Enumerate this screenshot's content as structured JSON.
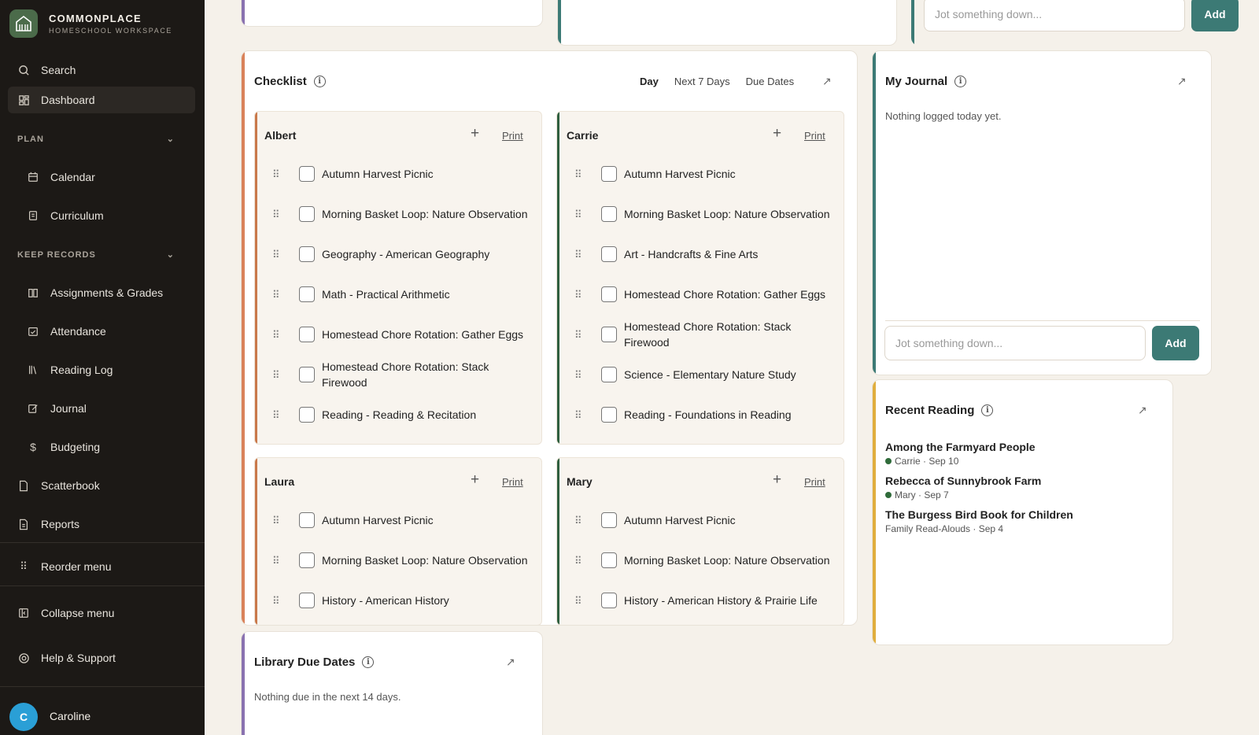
{
  "brand": {
    "name": "COMMONPLACE",
    "subtitle": "HOMESCHOOL WORKSPACE"
  },
  "nav": {
    "search": "Search",
    "dashboard": "Dashboard",
    "plan_section": "PLAN",
    "calendar": "Calendar",
    "curriculum": "Curriculum",
    "records_section": "KEEP RECORDS",
    "assignments": "Assignments & Grades",
    "attendance": "Attendance",
    "reading_log": "Reading Log",
    "journal": "Journal",
    "budgeting": "Budgeting",
    "scatterbook": "Scatterbook",
    "reports": "Reports",
    "reorder": "Reorder menu",
    "collapse": "Collapse menu",
    "help": "Help & Support"
  },
  "user": {
    "initial": "C",
    "name": "Caroline"
  },
  "top": {
    "jot_placeholder": "Jot something down...",
    "add": "Add"
  },
  "checklist": {
    "title": "Checklist",
    "tabs": [
      "Day",
      "Next 7 Days",
      "Due Dates"
    ],
    "print": "Print",
    "kids": [
      {
        "name": "Albert",
        "color": "#c9784a",
        "tasks": [
          "Autumn Harvest Picnic",
          "Morning Basket Loop: Nature Observation",
          "Geography - American Geography",
          "Math - Practical Arithmetic",
          "Homestead Chore Rotation: Gather Eggs",
          "Homestead Chore Rotation: Stack Firewood",
          "Reading - Reading & Recitation"
        ]
      },
      {
        "name": "Carrie",
        "color": "#2f5f3f",
        "tasks": [
          "Autumn Harvest Picnic",
          "Morning Basket Loop: Nature Observation",
          "Art - Handcrafts & Fine Arts",
          "Homestead Chore Rotation: Gather Eggs",
          "Homestead Chore Rotation: Stack Firewood",
          "Science - Elementary Nature Study",
          "Reading - Foundations in Reading"
        ]
      },
      {
        "name": "Laura",
        "color": "#c9784a",
        "tasks": [
          "Autumn Harvest Picnic",
          "Morning Basket Loop: Nature Observation",
          "History - American History"
        ]
      },
      {
        "name": "Mary",
        "color": "#2f5f3f",
        "tasks": [
          "Autumn Harvest Picnic",
          "Morning Basket Loop: Nature Observation",
          "History - American History & Prairie Life"
        ]
      }
    ]
  },
  "journal": {
    "title": "My Journal",
    "empty": "Nothing logged today yet.",
    "placeholder": "Jot something down...",
    "add": "Add"
  },
  "reading": {
    "title": "Recent Reading",
    "items": [
      {
        "title": "Among the Farmyard People",
        "meta": "Carrie · Sep 10",
        "dot": true
      },
      {
        "title": "Rebecca of Sunnybrook Farm",
        "meta": "Mary · Sep 7",
        "dot": true
      },
      {
        "title": "The Burgess Bird Book for Children",
        "meta": "Family Read-Alouds · Sep 4",
        "dot": false
      }
    ]
  },
  "library": {
    "title": "Library Due Dates",
    "empty": "Nothing due in the next 14 days."
  },
  "colors": {
    "accent": "#3c7a75",
    "sidebar": "#1c1916",
    "checklist_bar": "#d9825a",
    "journal_bar": "#3c7a75",
    "reading_bar": "#e0ae3e",
    "library_bar": "#8a72b0"
  }
}
